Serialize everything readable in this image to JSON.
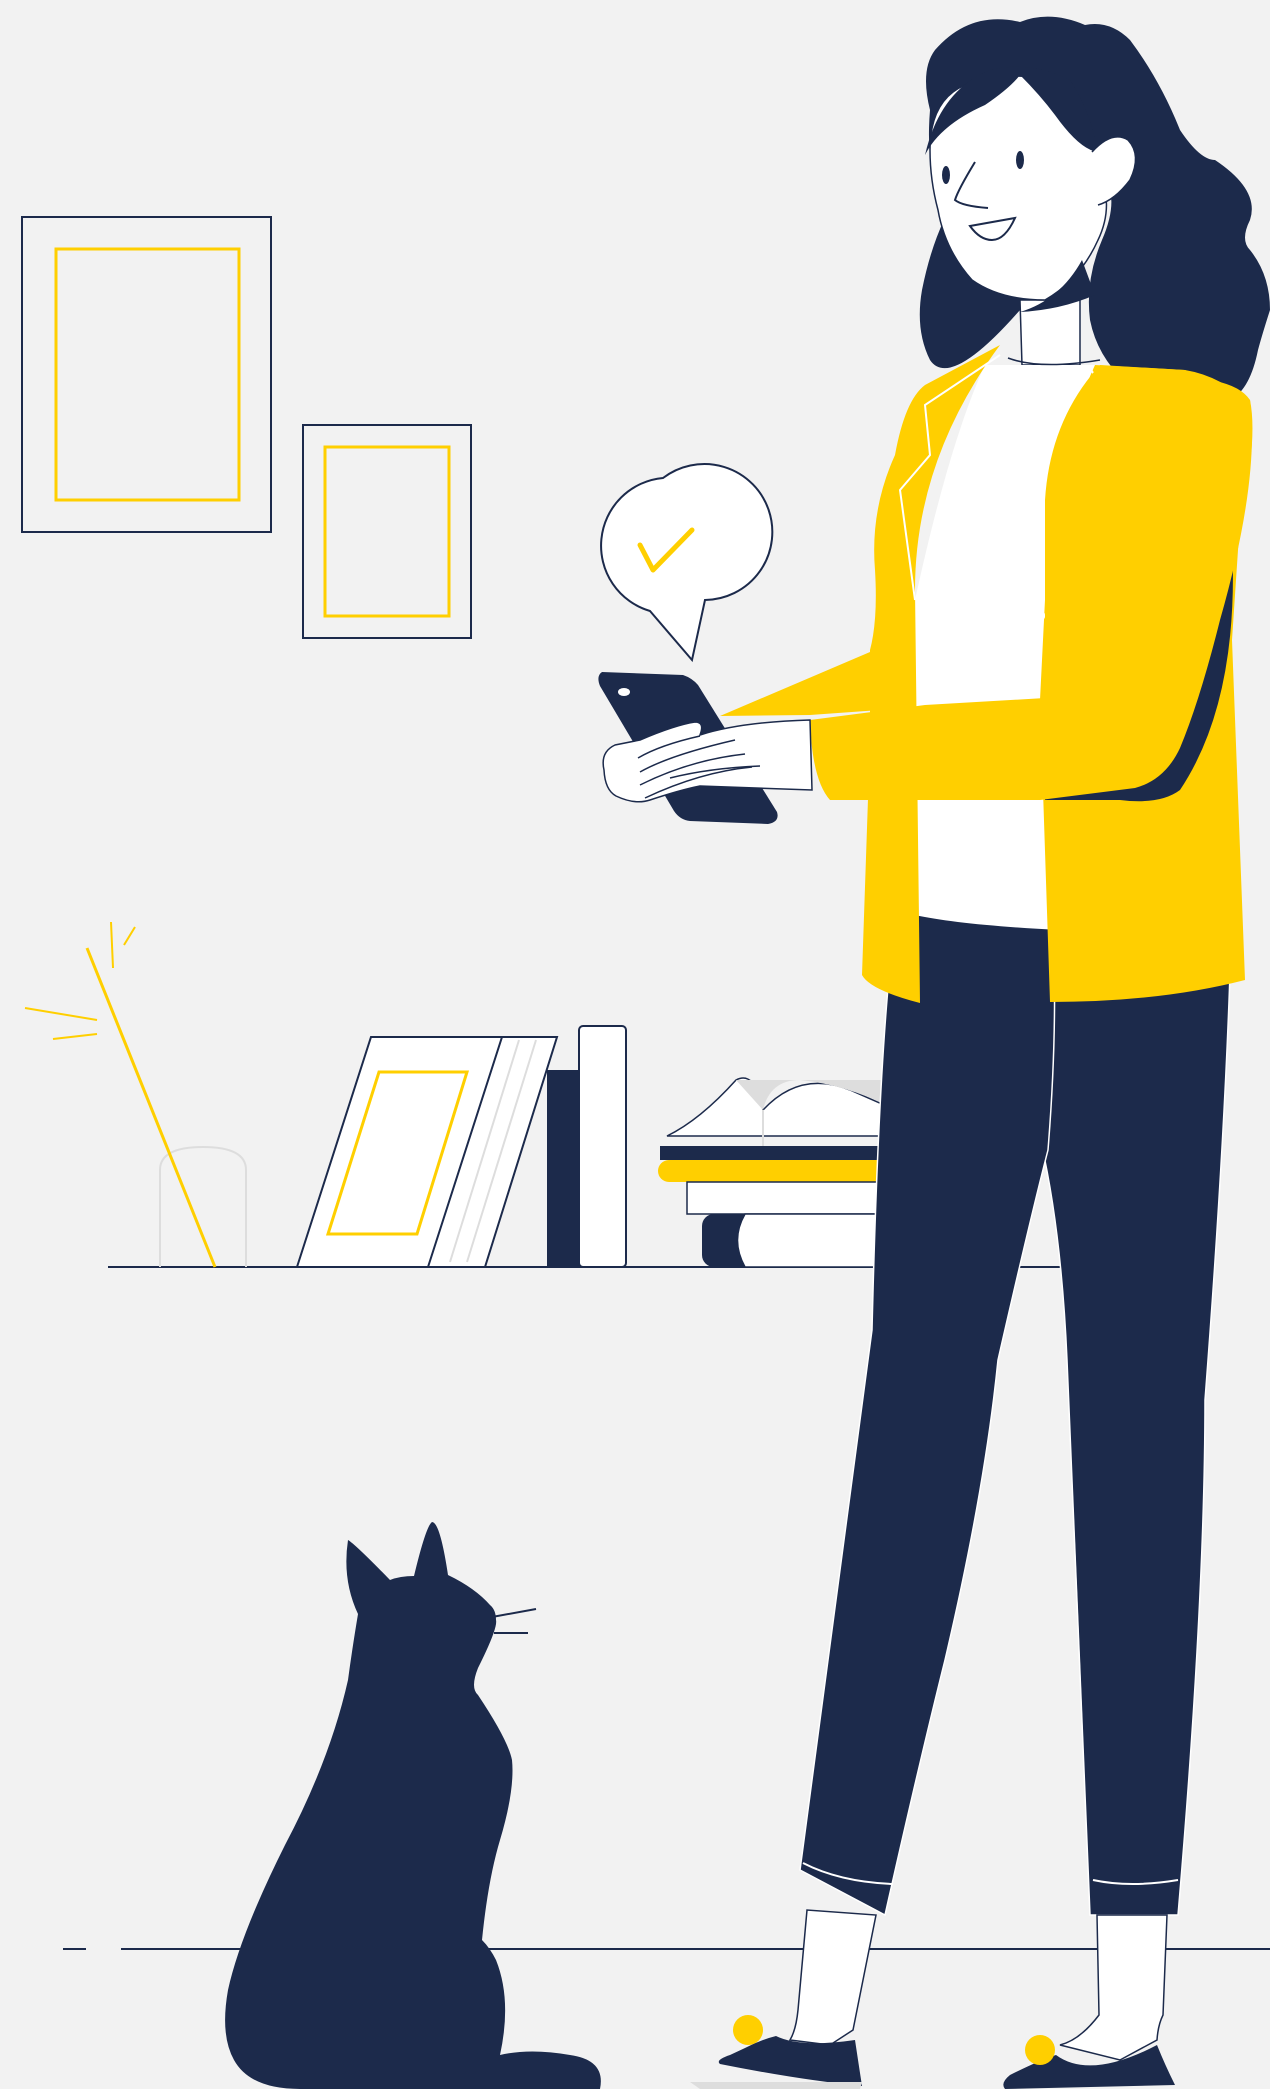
{
  "illustration": {
    "subject": "woman-with-phone-and-cat",
    "palette": {
      "background": "#f2f2f2",
      "navy": "#1c2a4b",
      "yellow": "#ffcf00",
      "white": "#ffffff",
      "light_gray": "#dddddd"
    },
    "icons": {
      "notification": "check-bubble-icon"
    }
  }
}
